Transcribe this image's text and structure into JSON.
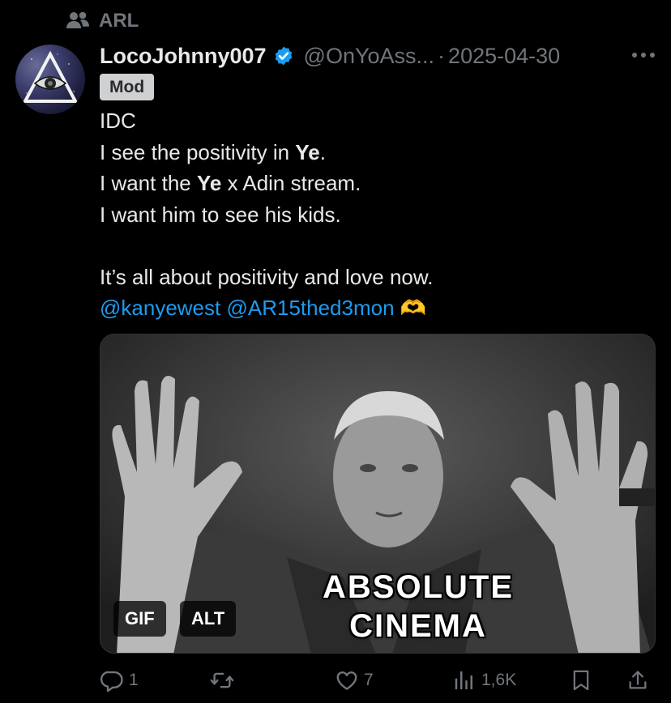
{
  "context": {
    "label": "ARL",
    "icon": "people-icon"
  },
  "author": {
    "display_name": "LocoJohnny007",
    "handle": "@OnYoAss...",
    "separator": "·",
    "date": "2025-04-30",
    "badge": "Mod",
    "verified_color": "#1d9bf0"
  },
  "post": {
    "lines": [
      {
        "parts": [
          "IDC"
        ]
      },
      {
        "pre": "I see the positivity in ",
        "bold": "Ye",
        "post": "."
      },
      {
        "pre": "I want the ",
        "bold": "Ye",
        "post": " x Adin stream."
      },
      {
        "parts": [
          "I want him to see his kids."
        ]
      },
      {
        "parts": [
          "It’s all about positivity and love now."
        ]
      }
    ],
    "mentions": [
      "@kanyewest",
      "@AR15thed3mon"
    ],
    "emoji": "🫶"
  },
  "media": {
    "caption_line1": "ABSOLUTE",
    "caption_line2": "CINEMA",
    "gif_label": "GIF",
    "alt_label": "ALT"
  },
  "actions": {
    "replies": "1",
    "reposts": "",
    "likes": "7",
    "views": "1,6K"
  },
  "colors": {
    "background": "#000000",
    "text": "#e7e9ea",
    "muted": "#71767b",
    "link": "#1d9bf0"
  }
}
